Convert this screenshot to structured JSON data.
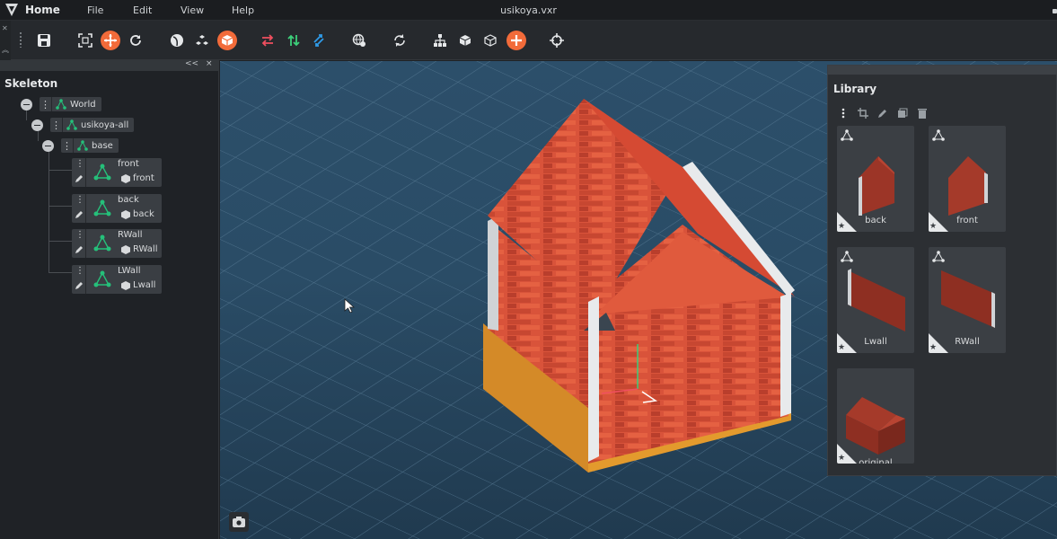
{
  "menubar": {
    "home": "Home",
    "menus": [
      "File",
      "Edit",
      "View",
      "Help"
    ],
    "document_title": "usikoya.vxr"
  },
  "colors": {
    "accent": "#f26b3a",
    "node_green": "#25c07a",
    "panel_bg": "#1f2226",
    "viewport_bg": "#2c4f6a"
  },
  "toolbar": {
    "tools": [
      "save-icon",
      "fit-icon",
      "move-icon",
      "refresh-icon",
      "sphere-icon",
      "group-icon",
      "box-icon",
      "swap-horizontal-icon",
      "swap-vertical-icon",
      "swap-diagonal-icon",
      "globe-icon",
      "rotate-icon",
      "hierarchy-icon",
      "solid-cube-icon",
      "wire-cube-icon",
      "add-icon",
      "target-icon"
    ]
  },
  "skeleton": {
    "title": "Skeleton",
    "header_collapse": "<<",
    "header_close": "×",
    "tree": [
      {
        "label": "World"
      },
      {
        "label": "usikoya-all"
      },
      {
        "label": "base"
      }
    ],
    "leaves": [
      {
        "name": "front",
        "mesh": "front"
      },
      {
        "name": "back",
        "mesh": "back"
      },
      {
        "name": "RWall",
        "mesh": "RWall"
      },
      {
        "name": "LWall",
        "mesh": "Lwall"
      }
    ]
  },
  "library": {
    "title": "Library",
    "tools": [
      "more-icon",
      "crop-icon",
      "edit-icon",
      "copy-icon",
      "delete-icon"
    ],
    "items": [
      {
        "label": "back"
      },
      {
        "label": "front"
      },
      {
        "label": "Lwall"
      },
      {
        "label": "RWall"
      },
      {
        "label": "original"
      }
    ]
  }
}
